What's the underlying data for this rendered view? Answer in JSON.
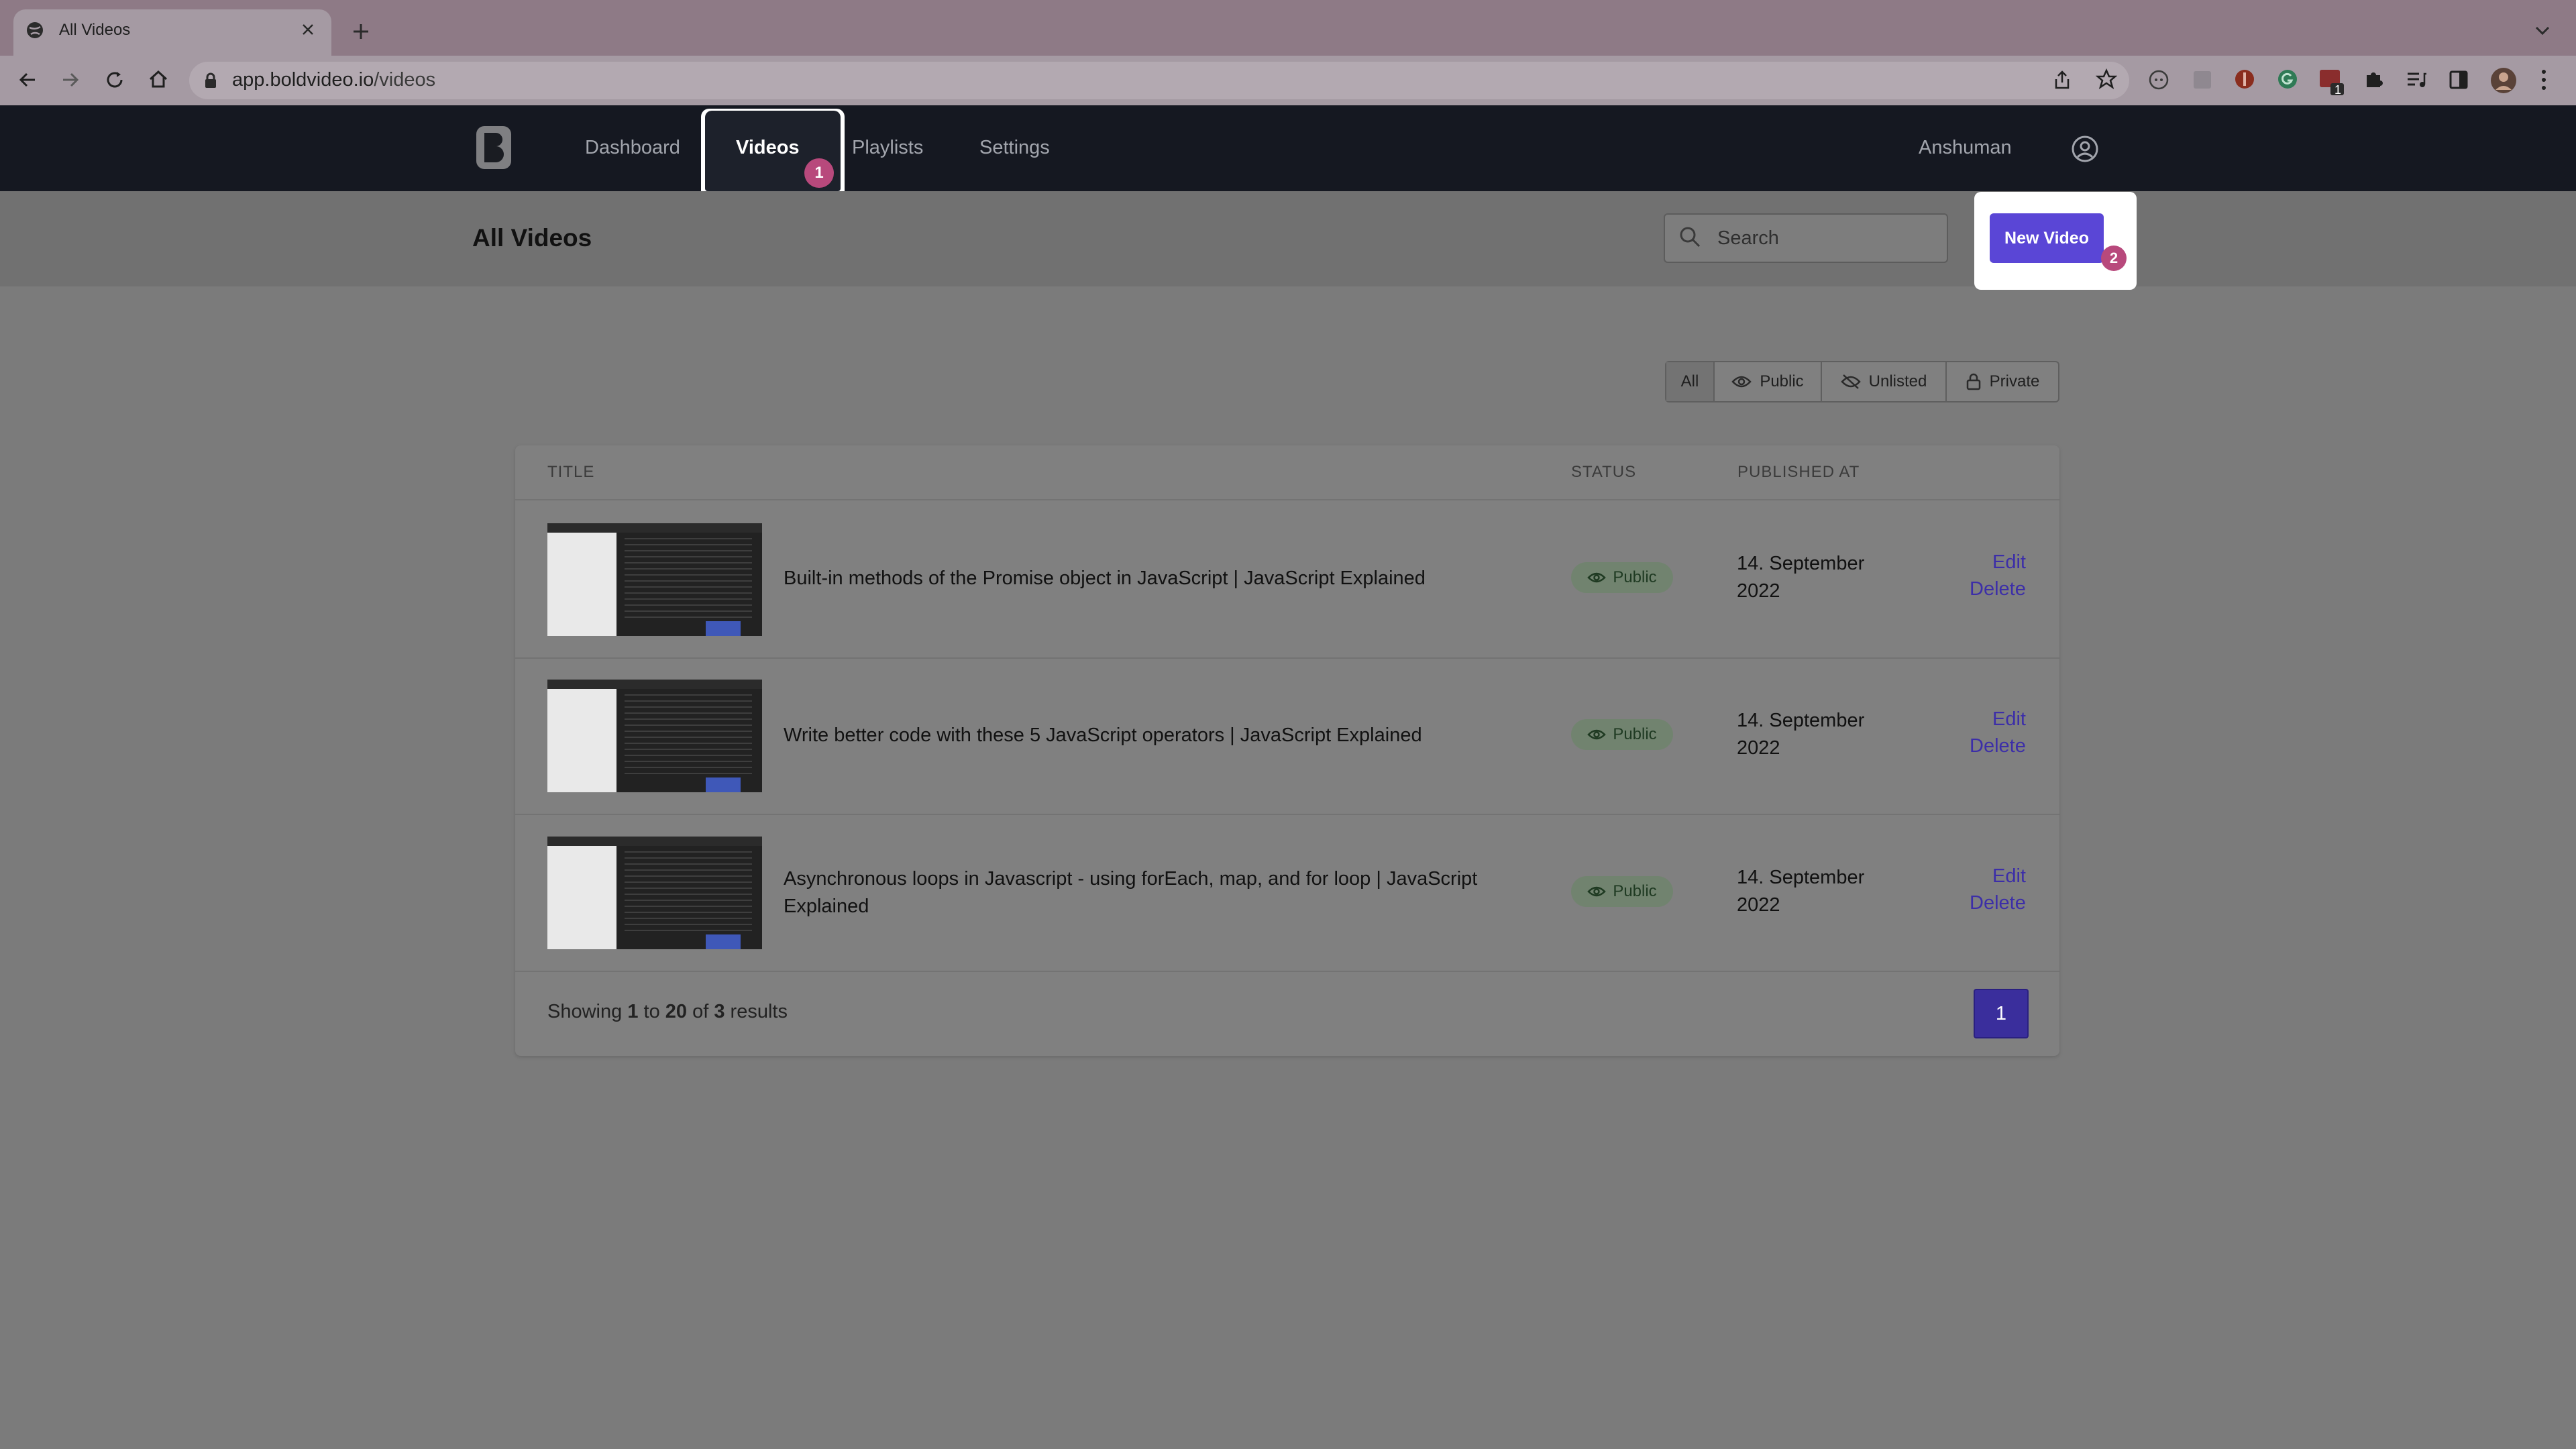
{
  "browser": {
    "tab_title": "All Videos",
    "url_host": "app.boldvideo.io",
    "url_path": "/videos",
    "extension_badge": "1"
  },
  "nav": {
    "dashboard": "Dashboard",
    "videos": "Videos",
    "playlists": "Playlists",
    "settings": "Settings",
    "user_name": "Anshuman",
    "videos_step_badge": "1"
  },
  "header": {
    "page_title": "All Videos",
    "search_placeholder": "Search",
    "new_video_label": "New Video",
    "new_video_step_badge": "2"
  },
  "filters": {
    "all": "All",
    "public": "Public",
    "unlisted": "Unlisted",
    "private": "Private"
  },
  "table": {
    "columns": {
      "title": "TITLE",
      "status": "STATUS",
      "published_at": "PUBLISHED AT"
    },
    "rows": [
      {
        "title": "Built-in methods of the Promise object in JavaScript | JavaScript Explained",
        "status": "Public",
        "published_line1": "14. September",
        "published_line2": "2022",
        "edit": "Edit",
        "delete": "Delete"
      },
      {
        "title": "Write better code with these 5 JavaScript operators | JavaScript Explained",
        "status": "Public",
        "published_line1": "14. September",
        "published_line2": "2022",
        "edit": "Edit",
        "delete": "Delete"
      },
      {
        "title_line1": "Asynchronous loops in Javascript - using forEach, map, and for loop | JavaScript",
        "title_line2": "Explained",
        "status": "Public",
        "published_line1": "14. September",
        "published_line2": "2022",
        "edit": "Edit",
        "delete": "Delete"
      }
    ]
  },
  "pagination": {
    "showing": "Showing",
    "from": "1",
    "to_word": "to",
    "to": "20",
    "of_word": "of",
    "total": "3",
    "results": "results",
    "current_page": "1"
  },
  "colors": {
    "accent": "#5a46d6",
    "step_badge": "#b8497c",
    "nav_bg": "#151821"
  }
}
